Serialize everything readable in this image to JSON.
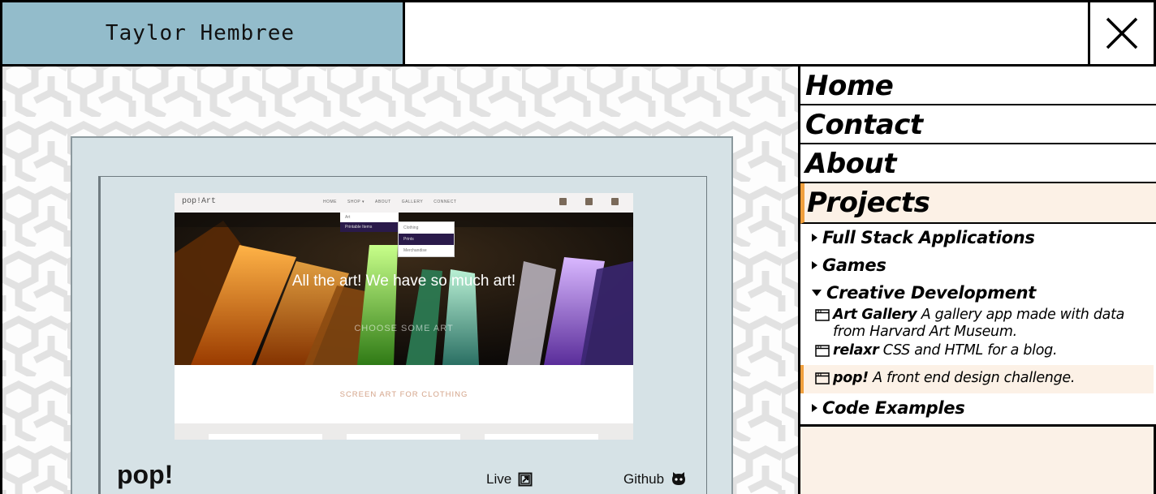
{
  "header": {
    "brand": "Taylor Hembree",
    "brand_color": "#93bccb",
    "close_icon": "close-icon"
  },
  "project_card": {
    "title": "pop!",
    "live_label": "Live",
    "github_label": "Github",
    "live_icon": "external-link-icon",
    "github_icon": "github-icon",
    "screenshot": {
      "logo": "pop!Art",
      "nav_links": [
        "HOME",
        "SHOP ▾",
        "ABOUT",
        "GALLERY",
        "CONNECT"
      ],
      "dropdown": [
        "Art",
        "Printable Items"
      ],
      "subdropdown": [
        "Clothing",
        "Prints",
        "Merchandise"
      ],
      "hero_heading": "All the art! We have so much art!",
      "hero_button": "CHOOSE SOME ART",
      "section_heading": "SCREEN ART FOR CLOTHING"
    }
  },
  "nav": {
    "items": [
      {
        "label": "Home"
      },
      {
        "label": "Contact"
      },
      {
        "label": "About"
      },
      {
        "label": "Projects"
      }
    ],
    "accent_color": "#f0a03e"
  },
  "projects": {
    "categories": [
      {
        "label": "Full Stack Applications",
        "expanded": false
      },
      {
        "label": "Games",
        "expanded": false
      },
      {
        "label": "Creative Development",
        "expanded": true
      },
      {
        "label": "Code Examples",
        "expanded": false
      }
    ],
    "creative": [
      {
        "name": "Art Gallery",
        "desc": "A gallery app made with data from Harvard Art Museum."
      },
      {
        "name": "relaxr",
        "desc": "CSS and HTML for a blog."
      },
      {
        "name": "pop!",
        "desc": "A front end design challenge."
      }
    ]
  }
}
